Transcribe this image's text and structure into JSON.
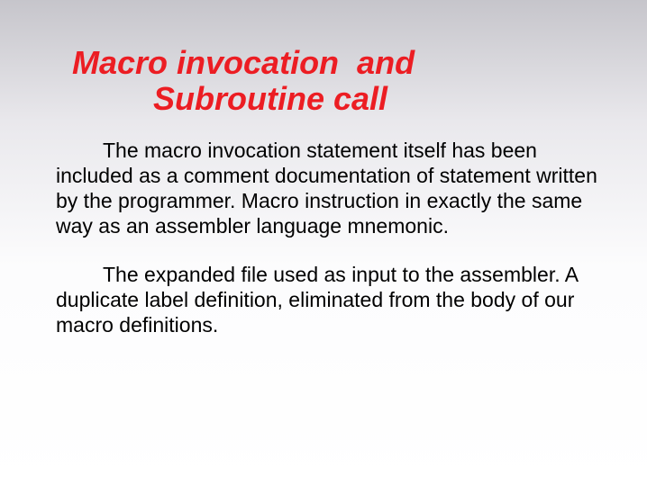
{
  "title": "Macro invocation  and\n         Subroutine call",
  "paragraph1": "The macro invocation statement itself has been included as a comment documentation of statement written by the programmer. Macro instruction in exactly the same way as an assembler language mnemonic.",
  "paragraph2": "The expanded file used as input to the assembler. A duplicate label definition, eliminated from the body of our macro definitions."
}
